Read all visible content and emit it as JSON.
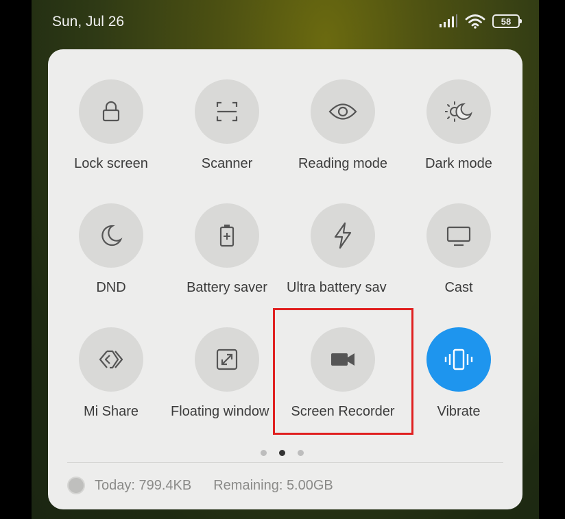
{
  "status_bar": {
    "date": "Sun, Jul 26",
    "battery_level": "58",
    "icons": [
      "signal-icon",
      "wifi-icon",
      "battery-icon"
    ]
  },
  "tiles": [
    {
      "label": "Lock screen",
      "icon": "lock-icon",
      "active": false
    },
    {
      "label": "Scanner",
      "icon": "scanner-icon",
      "active": false
    },
    {
      "label": "Reading mode",
      "icon": "eye-icon",
      "active": false
    },
    {
      "label": "Dark mode",
      "icon": "dark-mode-icon",
      "active": false
    },
    {
      "label": "DND",
      "icon": "moon-icon",
      "active": false
    },
    {
      "label": "Battery saver",
      "icon": "battery-saver-icon",
      "active": false
    },
    {
      "label": "Ultra battery sav",
      "icon": "lightning-icon",
      "active": false
    },
    {
      "label": "Cast",
      "icon": "monitor-icon",
      "active": false
    },
    {
      "label": "Mi Share",
      "icon": "mi-share-icon",
      "active": false
    },
    {
      "label": "Floating window",
      "icon": "floating-window-icon",
      "active": false
    },
    {
      "label": "Screen Recorder",
      "icon": "video-camera-icon",
      "active": false
    },
    {
      "label": "Vibrate",
      "icon": "vibrate-icon",
      "active": true
    }
  ],
  "pager": {
    "pages": 3,
    "current": 2
  },
  "usage": {
    "today": "Today: 799.4KB",
    "remaining": "Remaining: 5.00GB"
  },
  "colors": {
    "panel": "#ededec",
    "tile": "#d9d9d7",
    "active_tile": "#1e95ee",
    "highlight": "#e02020"
  }
}
